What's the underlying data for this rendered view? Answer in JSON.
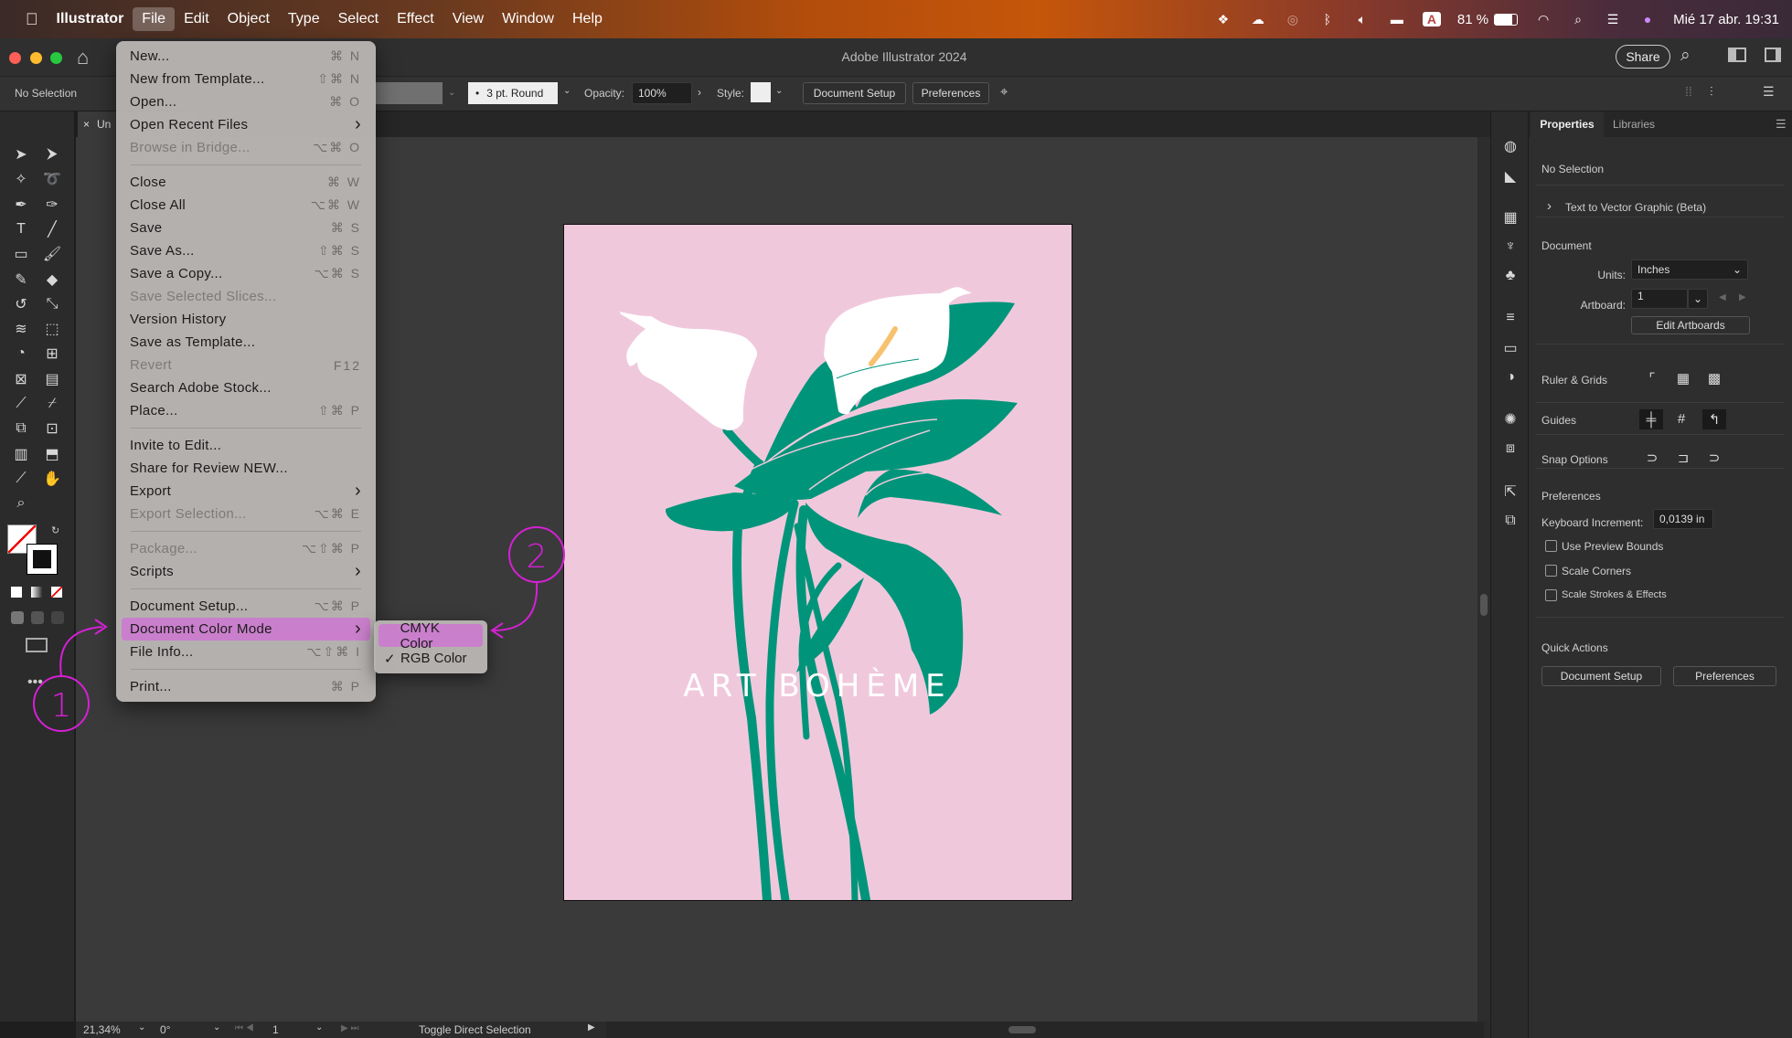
{
  "menubar": {
    "apple": "",
    "app": "Illustrator",
    "items": [
      "File",
      "Edit",
      "Object",
      "Type",
      "Select",
      "Effect",
      "View",
      "Window",
      "Help"
    ],
    "active": "File",
    "battery": "81 %",
    "datetime": "Mié 17 abr.  19:31",
    "keyboard_badge": "A"
  },
  "window": {
    "title": "Adobe Illustrator 2024",
    "share": "Share"
  },
  "controlbar": {
    "selection": "No Selection",
    "stroke": "3 pt. Round",
    "opacity_label": "Opacity:",
    "opacity_value": "100%",
    "style_label": "Style:",
    "document_setup": "Document Setup",
    "preferences": "Preferences"
  },
  "tab": {
    "close": "×",
    "label": "Un"
  },
  "file_menu": [
    {
      "label": "New...",
      "shortcut": "⌘ N"
    },
    {
      "label": "New from Template...",
      "shortcut": "⇧⌘ N"
    },
    {
      "label": "Open...",
      "shortcut": "⌘ O"
    },
    {
      "label": "Open Recent Files",
      "submenu": true
    },
    {
      "label": "Browse in Bridge...",
      "shortcut": "⌥⌘ O",
      "disabled": true
    },
    {
      "sep": true
    },
    {
      "label": "Close",
      "shortcut": "⌘ W"
    },
    {
      "label": "Close All",
      "shortcut": "⌥⌘ W"
    },
    {
      "label": "Save",
      "shortcut": "⌘ S"
    },
    {
      "label": "Save As...",
      "shortcut": "⇧⌘ S"
    },
    {
      "label": "Save a Copy...",
      "shortcut": "⌥⌘ S"
    },
    {
      "label": "Save Selected Slices...",
      "disabled": true
    },
    {
      "label": "Version History"
    },
    {
      "label": "Save as Template..."
    },
    {
      "label": "Revert",
      "shortcut": "F12",
      "disabled": true
    },
    {
      "label": "Search Adobe Stock..."
    },
    {
      "label": "Place...",
      "shortcut": "⇧⌘ P"
    },
    {
      "sep": true
    },
    {
      "label": "Invite to Edit..."
    },
    {
      "label": "Share for Review NEW..."
    },
    {
      "label": "Export",
      "submenu": true
    },
    {
      "label": "Export Selection...",
      "shortcut": "⌥⌘ E",
      "disabled": true
    },
    {
      "sep": true
    },
    {
      "label": "Package...",
      "shortcut": "⌥⇧⌘ P",
      "disabled": true
    },
    {
      "label": "Scripts",
      "submenu": true
    },
    {
      "sep": true
    },
    {
      "label": "Document Setup...",
      "shortcut": "⌥⌘ P"
    },
    {
      "label": "Document Color Mode",
      "submenu": true,
      "highlighted": true
    },
    {
      "label": "File Info...",
      "shortcut": "⌥⇧⌘ I"
    },
    {
      "sep": true
    },
    {
      "label": "Print...",
      "shortcut": "⌘ P"
    }
  ],
  "color_mode_submenu": [
    {
      "label": "CMYK Color",
      "checked": false,
      "highlighted": true
    },
    {
      "label": "RGB Color",
      "checked": true
    }
  ],
  "artwork": {
    "title": "ART BOHÈME",
    "colors": {
      "background": "#f0c8dc",
      "leaf": "#00957a",
      "flower": "#ffffff",
      "spadix": "#f7c26e"
    }
  },
  "annotations": {
    "step1": "1",
    "step2": "2",
    "color": "#d520d5"
  },
  "properties_panel": {
    "tabs": [
      "Properties",
      "Libraries"
    ],
    "selection": "No Selection",
    "text_to_vector": "Text to Vector Graphic (Beta)",
    "document_heading": "Document",
    "units_label": "Units:",
    "units_value": "Inches",
    "artboard_label": "Artboard:",
    "artboard_value": "1",
    "edit_artboards": "Edit Artboards",
    "ruler_grids": "Ruler & Grids",
    "guides": "Guides",
    "snap_options": "Snap Options",
    "preferences_heading": "Preferences",
    "keyboard_increment_label": "Keyboard Increment:",
    "keyboard_increment_value": "0,0139 in",
    "checkboxes": [
      {
        "label": "Use Preview Bounds",
        "checked": false
      },
      {
        "label": "Scale Corners",
        "checked": false
      },
      {
        "label": "Scale Strokes & Effects",
        "checked": false
      }
    ],
    "quick_actions": "Quick Actions",
    "qa_document_setup": "Document Setup",
    "qa_preferences": "Preferences"
  },
  "statusbar": {
    "zoom": "21,34%",
    "rotation": "0°",
    "artboard": "1",
    "tool_hint": "Toggle Direct Selection"
  }
}
